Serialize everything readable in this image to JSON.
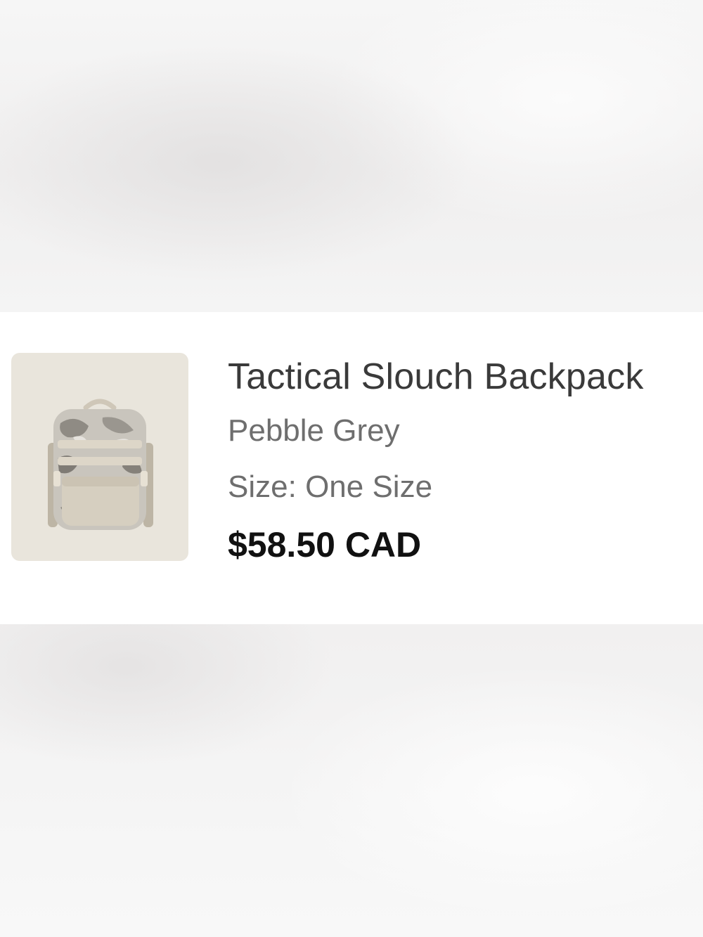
{
  "cart_item": {
    "image_alt": "Tactical Slouch Backpack in Pebble Grey",
    "title": "Tactical Slouch Backpack",
    "variant": "Pebble Grey",
    "size_label": "Size:",
    "size_value": "One Size",
    "price": "$58.50 CAD"
  },
  "colors": {
    "title": "#3a3a3a",
    "secondary_text": "#6e6e6e",
    "price": "#111111",
    "thumbnail_bg": "#e9e5dc"
  }
}
